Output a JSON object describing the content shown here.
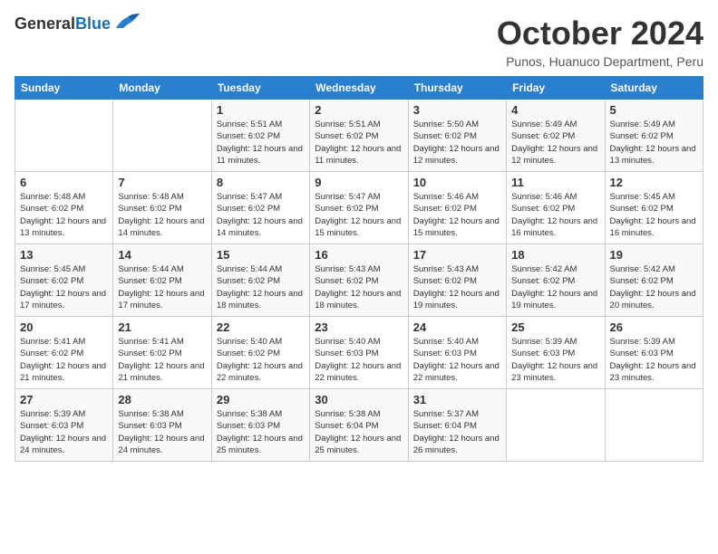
{
  "header": {
    "logo_general": "General",
    "logo_blue": "Blue",
    "month_title": "October 2024",
    "location": "Punos, Huanuco Department, Peru"
  },
  "days_of_week": [
    "Sunday",
    "Monday",
    "Tuesday",
    "Wednesday",
    "Thursday",
    "Friday",
    "Saturday"
  ],
  "weeks": [
    [
      {
        "day": "",
        "info": ""
      },
      {
        "day": "",
        "info": ""
      },
      {
        "day": "1",
        "info": "Sunrise: 5:51 AM\nSunset: 6:02 PM\nDaylight: 12 hours and 11 minutes."
      },
      {
        "day": "2",
        "info": "Sunrise: 5:51 AM\nSunset: 6:02 PM\nDaylight: 12 hours and 11 minutes."
      },
      {
        "day": "3",
        "info": "Sunrise: 5:50 AM\nSunset: 6:02 PM\nDaylight: 12 hours and 12 minutes."
      },
      {
        "day": "4",
        "info": "Sunrise: 5:49 AM\nSunset: 6:02 PM\nDaylight: 12 hours and 12 minutes."
      },
      {
        "day": "5",
        "info": "Sunrise: 5:49 AM\nSunset: 6:02 PM\nDaylight: 12 hours and 13 minutes."
      }
    ],
    [
      {
        "day": "6",
        "info": "Sunrise: 5:48 AM\nSunset: 6:02 PM\nDaylight: 12 hours and 13 minutes."
      },
      {
        "day": "7",
        "info": "Sunrise: 5:48 AM\nSunset: 6:02 PM\nDaylight: 12 hours and 14 minutes."
      },
      {
        "day": "8",
        "info": "Sunrise: 5:47 AM\nSunset: 6:02 PM\nDaylight: 12 hours and 14 minutes."
      },
      {
        "day": "9",
        "info": "Sunrise: 5:47 AM\nSunset: 6:02 PM\nDaylight: 12 hours and 15 minutes."
      },
      {
        "day": "10",
        "info": "Sunrise: 5:46 AM\nSunset: 6:02 PM\nDaylight: 12 hours and 15 minutes."
      },
      {
        "day": "11",
        "info": "Sunrise: 5:46 AM\nSunset: 6:02 PM\nDaylight: 12 hours and 16 minutes."
      },
      {
        "day": "12",
        "info": "Sunrise: 5:45 AM\nSunset: 6:02 PM\nDaylight: 12 hours and 16 minutes."
      }
    ],
    [
      {
        "day": "13",
        "info": "Sunrise: 5:45 AM\nSunset: 6:02 PM\nDaylight: 12 hours and 17 minutes."
      },
      {
        "day": "14",
        "info": "Sunrise: 5:44 AM\nSunset: 6:02 PM\nDaylight: 12 hours and 17 minutes."
      },
      {
        "day": "15",
        "info": "Sunrise: 5:44 AM\nSunset: 6:02 PM\nDaylight: 12 hours and 18 minutes."
      },
      {
        "day": "16",
        "info": "Sunrise: 5:43 AM\nSunset: 6:02 PM\nDaylight: 12 hours and 18 minutes."
      },
      {
        "day": "17",
        "info": "Sunrise: 5:43 AM\nSunset: 6:02 PM\nDaylight: 12 hours and 19 minutes."
      },
      {
        "day": "18",
        "info": "Sunrise: 5:42 AM\nSunset: 6:02 PM\nDaylight: 12 hours and 19 minutes."
      },
      {
        "day": "19",
        "info": "Sunrise: 5:42 AM\nSunset: 6:02 PM\nDaylight: 12 hours and 20 minutes."
      }
    ],
    [
      {
        "day": "20",
        "info": "Sunrise: 5:41 AM\nSunset: 6:02 PM\nDaylight: 12 hours and 21 minutes."
      },
      {
        "day": "21",
        "info": "Sunrise: 5:41 AM\nSunset: 6:02 PM\nDaylight: 12 hours and 21 minutes."
      },
      {
        "day": "22",
        "info": "Sunrise: 5:40 AM\nSunset: 6:02 PM\nDaylight: 12 hours and 22 minutes."
      },
      {
        "day": "23",
        "info": "Sunrise: 5:40 AM\nSunset: 6:03 PM\nDaylight: 12 hours and 22 minutes."
      },
      {
        "day": "24",
        "info": "Sunrise: 5:40 AM\nSunset: 6:03 PM\nDaylight: 12 hours and 22 minutes."
      },
      {
        "day": "25",
        "info": "Sunrise: 5:39 AM\nSunset: 6:03 PM\nDaylight: 12 hours and 23 minutes."
      },
      {
        "day": "26",
        "info": "Sunrise: 5:39 AM\nSunset: 6:03 PM\nDaylight: 12 hours and 23 minutes."
      }
    ],
    [
      {
        "day": "27",
        "info": "Sunrise: 5:39 AM\nSunset: 6:03 PM\nDaylight: 12 hours and 24 minutes."
      },
      {
        "day": "28",
        "info": "Sunrise: 5:38 AM\nSunset: 6:03 PM\nDaylight: 12 hours and 24 minutes."
      },
      {
        "day": "29",
        "info": "Sunrise: 5:38 AM\nSunset: 6:03 PM\nDaylight: 12 hours and 25 minutes."
      },
      {
        "day": "30",
        "info": "Sunrise: 5:38 AM\nSunset: 6:04 PM\nDaylight: 12 hours and 25 minutes."
      },
      {
        "day": "31",
        "info": "Sunrise: 5:37 AM\nSunset: 6:04 PM\nDaylight: 12 hours and 26 minutes."
      },
      {
        "day": "",
        "info": ""
      },
      {
        "day": "",
        "info": ""
      }
    ]
  ]
}
